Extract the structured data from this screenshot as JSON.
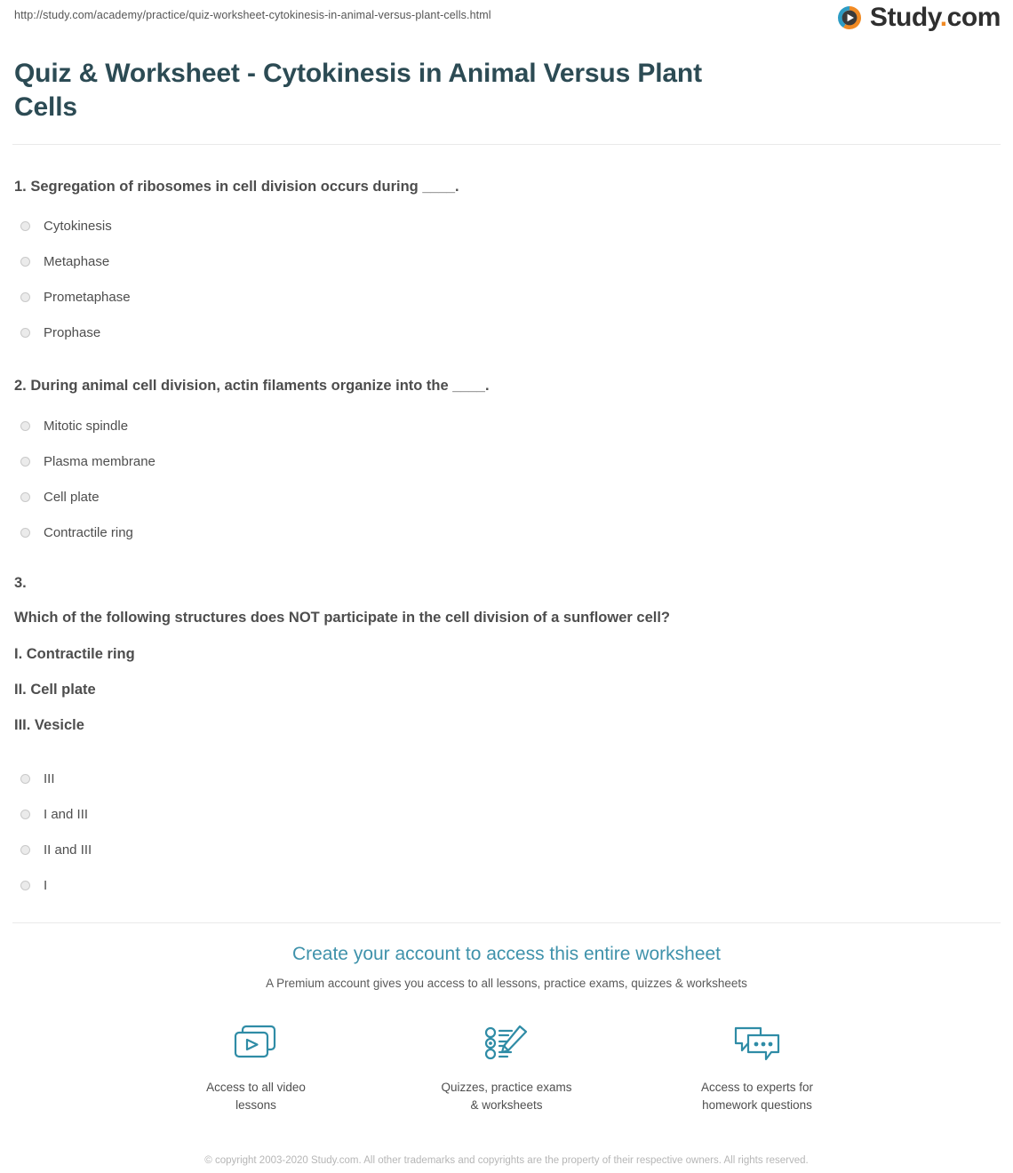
{
  "header": {
    "url": "http://study.com/academy/practice/quiz-worksheet-cytokinesis-in-animal-versus-plant-cells.html",
    "logo_text": "Study",
    "logo_dot": ".",
    "logo_suffix": "com",
    "logo_icon": "play-circle-icon"
  },
  "page_title": "Quiz & Worksheet - Cytokinesis in Animal Versus Plant Cells",
  "questions": [
    {
      "number": "1.",
      "prompt": "1. Segregation of ribosomes in cell division occurs during ____.",
      "options": [
        "Cytokinesis",
        "Metaphase",
        "Prometaphase",
        "Prophase"
      ]
    },
    {
      "number": "2.",
      "prompt": "2. During animal cell division, actin filaments organize into the ____.",
      "options": [
        "Mitotic spindle",
        "Plasma membrane",
        "Cell plate",
        "Contractile ring"
      ]
    },
    {
      "number": "3.",
      "prompt": "Which of the following structures does NOT participate in the cell division of a sunflower cell?",
      "roman_items": [
        "I. Contractile ring",
        "II. Cell plate",
        "III. Vesicle"
      ],
      "options": [
        "III",
        "I and III",
        "II and III",
        "I"
      ]
    }
  ],
  "cta": {
    "title": "Create your account to access this entire worksheet",
    "subtitle": "A Premium account gives you access to all lessons, practice exams, quizzes & worksheets",
    "features": [
      {
        "icon": "video-lessons-icon",
        "label": "Access to all\nvideo lessons"
      },
      {
        "icon": "quiz-checklist-pencil-icon",
        "label": "Quizzes, practice exams\n& worksheets"
      },
      {
        "icon": "chat-bubbles-icon",
        "label": "Access to experts for\nhomework questions"
      }
    ]
  },
  "copyright": "© copyright 2003-2020 Study.com. All other trademarks and copyrights are the property of their respective owners. All rights reserved.",
  "colors": {
    "title": "#2c4b54",
    "cta_title": "#3f92ab",
    "icon_teal": "#2f8ca6",
    "logo_dot_orange": "#f08a24",
    "logo_ring_blue": "#2d9cc4",
    "logo_ring_orange": "#f08a24"
  }
}
